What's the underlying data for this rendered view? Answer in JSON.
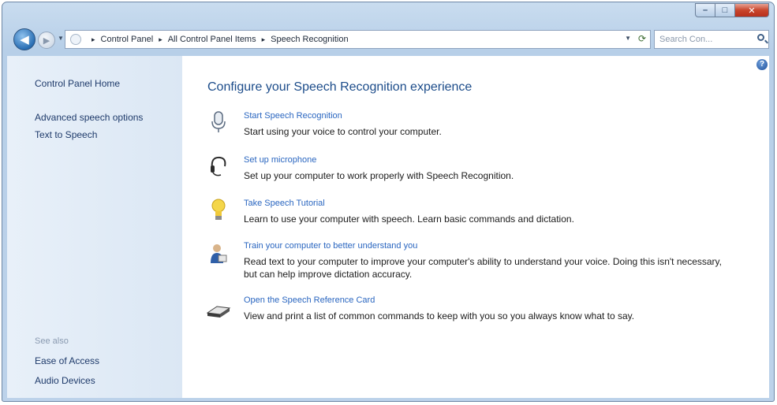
{
  "window": {
    "caption": {
      "minimize": "–",
      "maximize": "□",
      "close": "✕"
    }
  },
  "nav": {
    "back_glyph": "◀",
    "forward_glyph": "▶",
    "breadcrumbs": [
      "Control Panel",
      "All Control Panel Items",
      "Speech Recognition"
    ],
    "breadcrumb_separator": "▸",
    "search_placeholder": "Search Con..."
  },
  "sidebar": {
    "home_link": "Control Panel Home",
    "links": [
      "Advanced speech options",
      "Text to Speech"
    ],
    "see_also_label": "See also",
    "see_also_links": [
      "Ease of Access",
      "Audio Devices"
    ]
  },
  "main": {
    "title": "Configure your Speech Recognition experience",
    "tasks": [
      {
        "icon": "microphone-icon",
        "link": "Start Speech Recognition",
        "description": "Start using your voice to control your computer."
      },
      {
        "icon": "headset-icon",
        "link": "Set up microphone",
        "description": "Set up your computer to work properly with Speech Recognition."
      },
      {
        "icon": "lightbulb-icon",
        "link": "Take Speech Tutorial",
        "description": "Learn to use your computer with speech.  Learn basic commands and dictation."
      },
      {
        "icon": "user-training-icon",
        "link": "Train your computer to better understand you",
        "description": "Read text to your computer to improve your computer's ability to understand your voice. Doing this isn't necessary, but can help improve dictation accuracy."
      },
      {
        "icon": "printer-icon",
        "link": "Open the Speech Reference Card",
        "description": "View and print a list of common commands to keep with you so you always know what to say."
      }
    ]
  },
  "colors": {
    "link": "#2a66c0",
    "title": "#1c4c8a",
    "sidebar_bg": "#e3edf8",
    "close_button": "#c8452c"
  }
}
